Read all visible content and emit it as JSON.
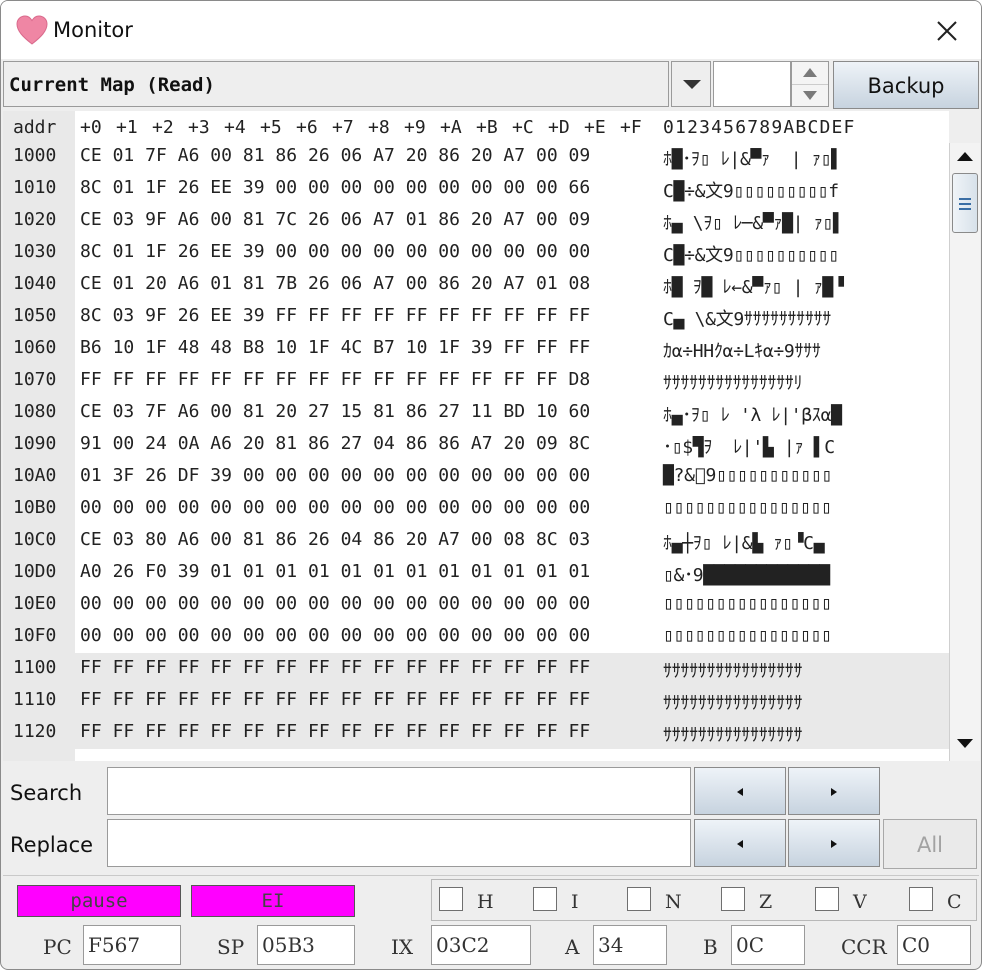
{
  "window": {
    "title": "Monitor"
  },
  "toolbar": {
    "map_select": "Current Map (Read)",
    "spin_value": "",
    "backup_label": "Backup"
  },
  "hex": {
    "addr_header": "addr",
    "col_headers": [
      "+0",
      "+1",
      "+2",
      "+3",
      "+4",
      "+5",
      "+6",
      "+7",
      "+8",
      "+9",
      "+A",
      "+B",
      "+C",
      "+D",
      "+E",
      "+F"
    ],
    "ascii_header": "0123456789ABCDEF",
    "rows": [
      {
        "addr": "1000",
        "bytes": "CE 01 7F A6 00 81 86 26 06 A7 20 86 20 A7 00 09",
        "ascii": "ﾎ█･ｦ▯ ﾚ|&▀ｧ  | ｧ▯▌"
      },
      {
        "addr": "1010",
        "bytes": "8C 01 1F 26 EE 39 00 00 00 00 00 00 00 00 00 66",
        "ascii": "C█÷&文9▯▯▯▯▯▯▯▯▯f"
      },
      {
        "addr": "1020",
        "bytes": "CE 03 9F A6 00 81 7C 26 06 A7 01 86 20 A7 00 09",
        "ascii": "ﾎ▄ \\ｦ▯ ﾚ─&▀ｧ█| ｧ▯▌"
      },
      {
        "addr": "1030",
        "bytes": "8C 01 1F 26 EE 39 00 00 00 00 00 00 00 00 00 00",
        "ascii": "C█÷&文9▯▯▯▯▯▯▯▯▯▯"
      },
      {
        "addr": "1040",
        "bytes": "CE 01 20 A6 01 81 7B 26 06 A7 00 86 20 A7 01 08",
        "ascii": "ﾎ█ ｦ█ ﾚ←&▀ｧ▯ | ｧ█▝"
      },
      {
        "addr": "1050",
        "bytes": "8C 03 9F 26 EE 39 FF FF FF FF FF FF FF FF FF FF",
        "ascii": "C▄ \\&文9ｻｻｻｻｻｻｻｻｻｻ"
      },
      {
        "addr": "1060",
        "bytes": "B6 10 1F 48 48 B8 10 1F 4C B7 10 1F 39 FF FF FF",
        "ascii": "ｶα÷HHｸα÷Lｷα÷9ｻｻｻ"
      },
      {
        "addr": "1070",
        "bytes": "FF FF FF FF FF FF FF FF FF FF FF FF FF FF FF D8",
        "ascii": "ｻｻｻｻｻｻｻｻｻｻｻｻｻｻｻﾘ"
      },
      {
        "addr": "1080",
        "bytes": "CE 03 7F A6 00 81 20 27 15 81 86 27 11 BD 10 60",
        "ascii": "ﾎ▄･ｦ▯ ﾚ 'λ ﾚ|'βｽα█"
      },
      {
        "addr": "1090",
        "bytes": "91 00 24 0A A6 20 81 86 27 04 86 86 A7 20 09 8C",
        "ascii": "･▯$▜ｦ  ﾚ|'▙ |ｧ ▌C"
      },
      {
        "addr": "10A0",
        "bytes": "01 3F 26 DF 39 00 00 00 00 00 00 00 00 00 00 00",
        "ascii": "█?&ﾟ9▯▯▯▯▯▯▯▯▯▯▯"
      },
      {
        "addr": "10B0",
        "bytes": "00 00 00 00 00 00 00 00 00 00 00 00 00 00 00 00",
        "ascii": "▯▯▯▯▯▯▯▯▯▯▯▯▯▯▯▯"
      },
      {
        "addr": "10C0",
        "bytes": "CE 03 80 A6 00 81 86 26 04 86 20 A7 00 08 8C 03",
        "ascii": "ﾎ▄┼ｦ▯ ﾚ|&▙ ｧ▯▝C▄"
      },
      {
        "addr": "10D0",
        "bytes": "A0 26 F0 39 01 01 01 01 01 01 01 01 01 01 01 01",
        "ascii": "▯&･9████████████"
      },
      {
        "addr": "10E0",
        "bytes": "00 00 00 00 00 00 00 00 00 00 00 00 00 00 00 00",
        "ascii": "▯▯▯▯▯▯▯▯▯▯▯▯▯▯▯▯"
      },
      {
        "addr": "10F0",
        "bytes": "00 00 00 00 00 00 00 00 00 00 00 00 00 00 00 00",
        "ascii": "▯▯▯▯▯▯▯▯▯▯▯▯▯▯▯▯"
      },
      {
        "addr": "1100",
        "bytes": "FF FF FF FF FF FF FF FF FF FF FF FF FF FF FF FF",
        "ascii": "ｻｻｻｻｻｻｻｻｻｻｻｻｻｻｻｻ"
      },
      {
        "addr": "1110",
        "bytes": "FF FF FF FF FF FF FF FF FF FF FF FF FF FF FF FF",
        "ascii": "ｻｻｻｻｻｻｻｻｻｻｻｻｻｻｻｻ"
      },
      {
        "addr": "1120",
        "bytes": "FF FF FF FF FF FF FF FF FF FF FF FF FF FF FF FF",
        "ascii": "ｻｻｻｻｻｻｻｻｻｻｻｻｻｻｻｻ"
      }
    ]
  },
  "search": {
    "label": "Search",
    "value": ""
  },
  "replace": {
    "label": "Replace",
    "value": "",
    "all_label": "All"
  },
  "status": {
    "pause_label": "pause",
    "ei_label": "EI",
    "accent": "#ff00ff"
  },
  "flags": [
    "H",
    "I",
    "N",
    "Z",
    "V",
    "C"
  ],
  "registers": {
    "pc_label": "PC",
    "pc": "F567",
    "sp_label": "SP",
    "sp": "05B3",
    "ix_label": "IX",
    "ix": "03C2",
    "a_label": "A",
    "a": "34",
    "b_label": "B",
    "b": "0C",
    "ccr_label": "CCR",
    "ccr": "C0"
  }
}
